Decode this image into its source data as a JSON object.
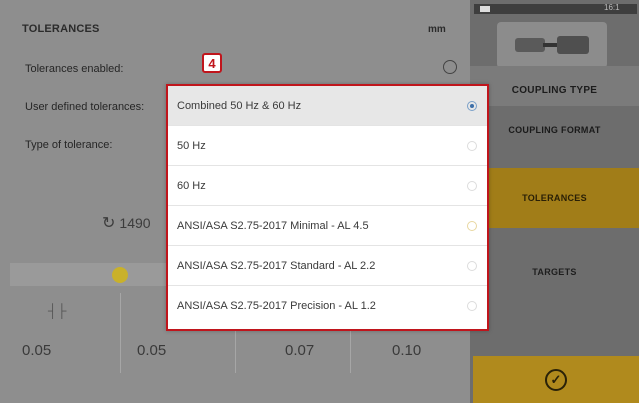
{
  "header": {
    "title": "TOLERANCES",
    "unit": "mm"
  },
  "rows": {
    "tolerances_enabled": "Tolerances enabled:",
    "user_defined": "User defined tolerances:",
    "type_of_tolerance": "Type of tolerance:"
  },
  "rpm": {
    "symbol": "↻",
    "value": "1490"
  },
  "grid_values": [
    "0.05",
    "0.05",
    "0.07",
    "0.10"
  ],
  "dropdown": {
    "badge": "4",
    "options": [
      {
        "label": "Combined 50 Hz & 60 Hz",
        "selected": true
      },
      {
        "label": "50 Hz",
        "selected": false
      },
      {
        "label": "60 Hz",
        "selected": false
      },
      {
        "label": "ANSI/ASA S2.75-2017 Minimal - AL 4.5",
        "selected": false
      },
      {
        "label": "ANSI/ASA S2.75-2017 Standard - AL 2.2",
        "selected": false
      },
      {
        "label": "ANSI/ASA S2.75-2017 Precision - AL 1.2",
        "selected": false
      }
    ]
  },
  "sidebar": {
    "clock": "16:1",
    "items": [
      {
        "label": "COUPLING TYPE"
      },
      {
        "label": "COUPLING FORMAT"
      },
      {
        "label": "TOLERANCES"
      },
      {
        "label": "TARGETS"
      }
    ]
  },
  "colors": {
    "accent": "#c0151c",
    "active_menu": "#a17d18",
    "ok_button": "#b08a1d"
  }
}
